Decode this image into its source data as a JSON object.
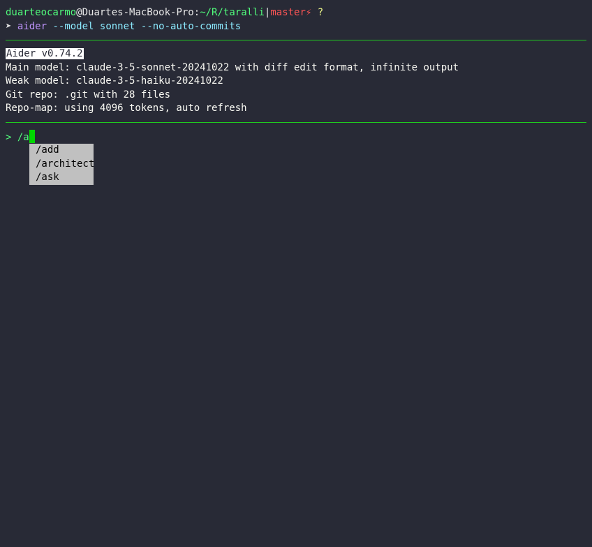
{
  "prompt": {
    "user": "duarteocarmo",
    "at": "@",
    "host": "Duartes-MacBook-Pro",
    "colon": ":",
    "path": "~/R/taralli",
    "separator": "|",
    "branch": "master",
    "dirty_symbol": "⚡",
    "status": "?",
    "arrow": "➤",
    "cmd": "aider",
    "args": "--model sonnet --no-auto-commits"
  },
  "info": {
    "version": "Aider v0.74.2",
    "main_model": "Main model: claude-3-5-sonnet-20241022 with diff edit format, infinite output",
    "weak_model": "Weak model: claude-3-5-haiku-20241022",
    "git_repo": "Git repo: .git with 28 files",
    "repo_map": "Repo-map: using 4096 tokens, auto refresh"
  },
  "input": {
    "prompt_symbol": ">",
    "value": "/a"
  },
  "completions": [
    "/add",
    "/architect",
    "/ask"
  ]
}
